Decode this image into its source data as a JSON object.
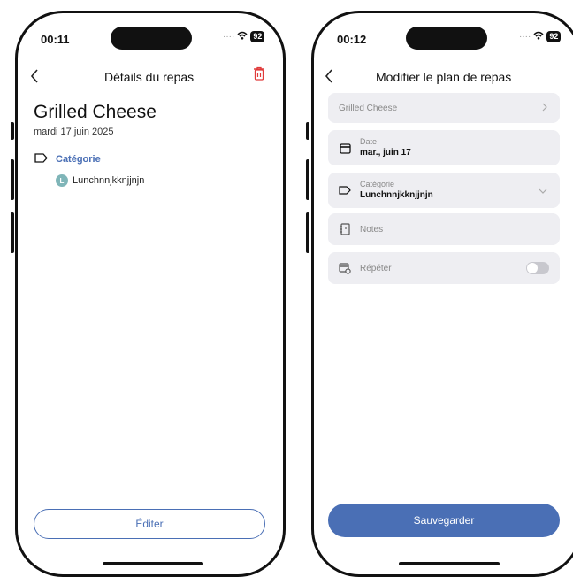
{
  "screen1": {
    "status": {
      "time": "00:11",
      "battery": "92"
    },
    "nav": {
      "title": "Détails du repas"
    },
    "meal": {
      "title": "Grilled Cheese",
      "date": "mardi 17 juin 2025"
    },
    "category": {
      "label": "Catégorie",
      "value": "Lunchnnjkknjjnjn",
      "badge": "L"
    },
    "edit_label": "Éditer"
  },
  "screen2": {
    "status": {
      "time": "00:12",
      "battery": "92"
    },
    "nav": {
      "title": "Modifier le plan de repas"
    },
    "recipe": {
      "value": "Grilled Cheese"
    },
    "date": {
      "label": "Date",
      "value": "mar., juin 17"
    },
    "category": {
      "label": "Catégorie",
      "value": "Lunchnnjkknjjnjn"
    },
    "notes": {
      "placeholder": "Notes"
    },
    "repeat": {
      "label": "Répéter",
      "enabled": false
    },
    "save_label": "Sauvegarder"
  },
  "colors": {
    "accent": "#4a6fb5",
    "delete": "#e03a3a",
    "field_bg": "#eeeef2"
  }
}
